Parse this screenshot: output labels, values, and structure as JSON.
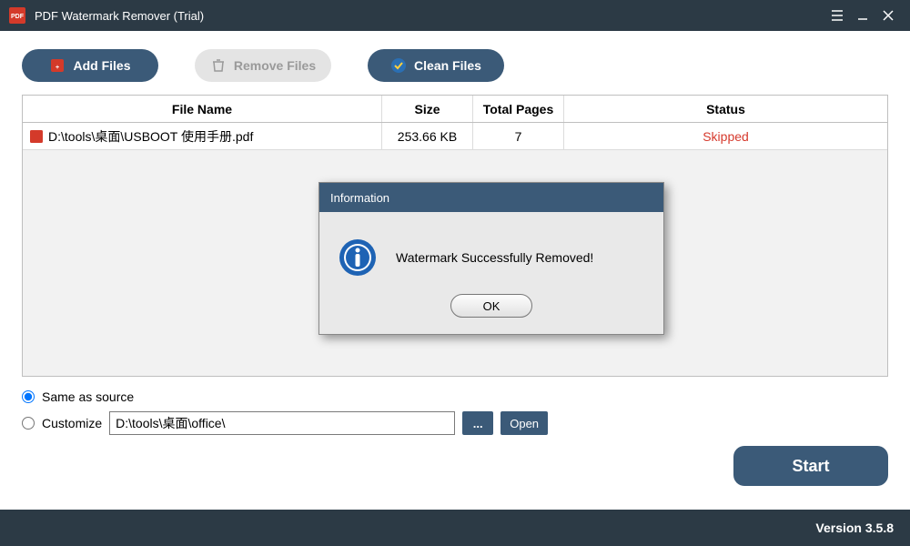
{
  "window": {
    "title": "PDF Watermark Remover (Trial)"
  },
  "toolbar": {
    "add_files": "Add Files",
    "remove_files": "Remove Files",
    "clean_files": "Clean Files"
  },
  "grid": {
    "headers": {
      "name": "File Name",
      "size": "Size",
      "pages": "Total Pages",
      "status": "Status"
    },
    "rows": [
      {
        "name": "D:\\tools\\桌面\\USBOOT 使用手册.pdf",
        "size": "253.66 KB",
        "pages": "7",
        "status": "Skipped"
      }
    ]
  },
  "output": {
    "same_as_source_label": "Same as source",
    "customize_label": "Customize",
    "path": "D:\\tools\\桌面\\office\\",
    "browse_label": "...",
    "open_label": "Open",
    "selected": "same"
  },
  "start_label": "Start",
  "footer": {
    "version": "Version 3.5.8"
  },
  "dialog": {
    "title": "Information",
    "message": "Watermark Successfully Removed!",
    "ok_label": "OK"
  }
}
